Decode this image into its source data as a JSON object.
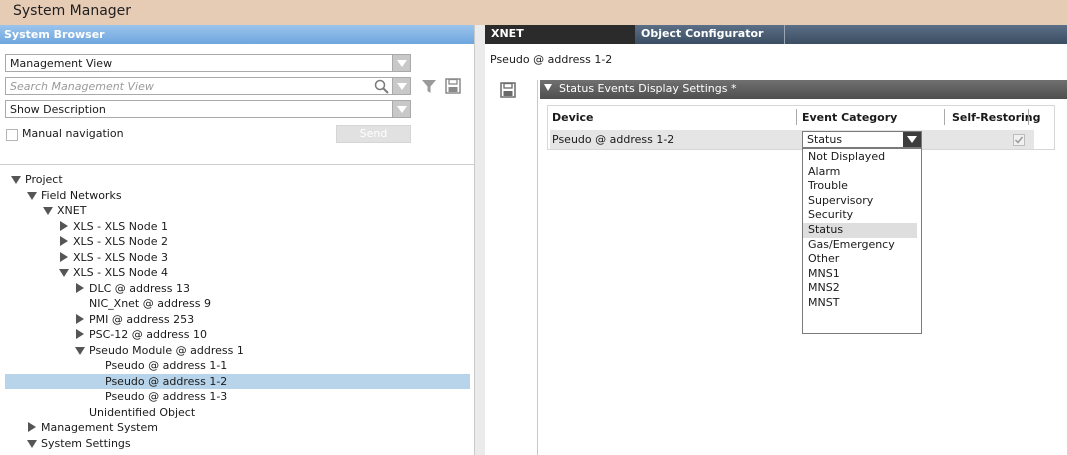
{
  "app": {
    "title": "System Manager"
  },
  "browser": {
    "header": "System Browser",
    "view_select": "Management View",
    "search_placeholder": "Search Management View",
    "description_select": "Show Description",
    "manual_nav_label": "Manual navigation",
    "send_label": "Send"
  },
  "tree": [
    {
      "label": "Project",
      "depth": 0,
      "state": "expanded"
    },
    {
      "label": "Field Networks",
      "depth": 1,
      "state": "expanded"
    },
    {
      "label": "XNET",
      "depth": 2,
      "state": "expanded"
    },
    {
      "label": "XLS - XLS Node 1",
      "depth": 3,
      "state": "collapsed"
    },
    {
      "label": "XLS - XLS Node 2",
      "depth": 3,
      "state": "collapsed"
    },
    {
      "label": "XLS - XLS Node 3",
      "depth": 3,
      "state": "collapsed"
    },
    {
      "label": "XLS - XLS Node 4",
      "depth": 3,
      "state": "expanded"
    },
    {
      "label": "DLC @ address 13",
      "depth": 4,
      "state": "collapsed"
    },
    {
      "label": "NIC_Xnet @ address 9",
      "depth": 4,
      "state": "leaf"
    },
    {
      "label": "PMI @ address 253",
      "depth": 4,
      "state": "collapsed"
    },
    {
      "label": "PSC-12 @ address 10",
      "depth": 4,
      "state": "collapsed"
    },
    {
      "label": "Pseudo Module @ address 1",
      "depth": 4,
      "state": "expanded"
    },
    {
      "label": "Pseudo @ address 1-1",
      "depth": 5,
      "state": "leaf"
    },
    {
      "label": "Pseudo @ address 1-2",
      "depth": 5,
      "state": "leaf",
      "selected": true
    },
    {
      "label": "Pseudo @ address 1-3",
      "depth": 5,
      "state": "leaf"
    },
    {
      "label": "Unidentified Object",
      "depth": 4,
      "state": "leaf"
    },
    {
      "label": "Management System",
      "depth": 1,
      "state": "collapsed"
    },
    {
      "label": "System Settings",
      "depth": 1,
      "state": "expanded"
    }
  ],
  "tabs": [
    {
      "label": "XNET",
      "active": true
    },
    {
      "label": "Object Configurator",
      "active": false
    }
  ],
  "object_name": "Pseudo @ address 1-2",
  "section": {
    "title": "Status Events Display Settings *"
  },
  "grid": {
    "columns": [
      "Device",
      "Event Category",
      "Self-Restoring"
    ],
    "row": {
      "device": "Pseudo @ address 1-2",
      "category": "Status",
      "self_restoring": true
    }
  },
  "dropdown": {
    "options": [
      "Not Displayed",
      "Alarm",
      "Trouble",
      "Supervisory",
      "Security",
      "Status",
      "Gas/Emergency",
      "Other",
      "MNS1",
      "MNS2",
      "MNST"
    ],
    "selected": "Status"
  },
  "colors": {
    "title_bar": "#e6cbb5",
    "header_blue": "#6ea6de",
    "selection": "#b8d4ea"
  },
  "icons": [
    "search-icon",
    "filter-icon",
    "save-icon",
    "checkmark-icon"
  ]
}
